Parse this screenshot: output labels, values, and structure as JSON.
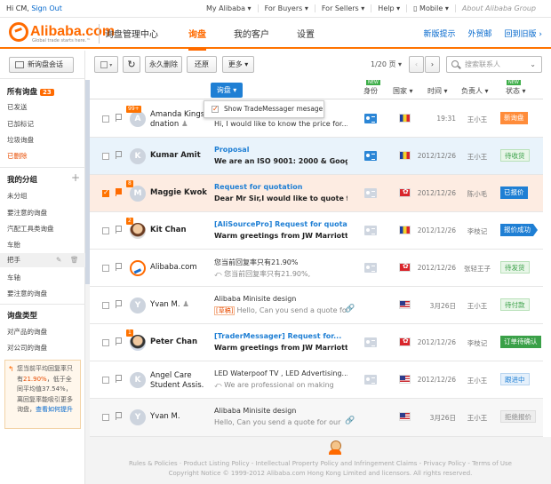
{
  "topbar": {
    "greeting": "Hi CM,",
    "sign_out": "Sign Out",
    "links": [
      "My Alibaba ▾",
      "For Buyers ▾",
      "For Sellers ▾",
      "Help ▾",
      "▯ Mobile ▾",
      "About Alibaba Group"
    ]
  },
  "header": {
    "logo_text": "Alibaba.com",
    "logo_slogan": "Global trade starts here.™",
    "app_title": "询盘管理中心",
    "nav": [
      "询盘",
      "我的客户",
      "设置"
    ],
    "links": [
      "新版提示",
      "外贸邮",
      "回到旧版 ›"
    ]
  },
  "sidebar": {
    "new_inquiry": "新询盘会话",
    "all_inquiries": "所有询盘",
    "all_count": "23",
    "items": [
      "已发送",
      "已加标记",
      "垃圾询盘",
      "已删除"
    ],
    "groups_title": "我的分组",
    "groups": [
      "未分组",
      "要注意的询盘",
      "汽配工具类询盘",
      "车胎",
      "把手",
      "车轴",
      "要注意的询盘"
    ],
    "types_title": "询盘类型",
    "types": [
      "对产品的询盘",
      "对公司的询盘"
    ],
    "promo_pre": "您当前平均回复率只有",
    "promo_rate": "21.90%",
    "promo_mid": "，低于全同平均值",
    "promo_avg": "37.54%",
    "promo_post": "，离回复率能吸引更多询盘，",
    "promo_link": "查看如何提升"
  },
  "toolbar": {
    "delete_forever": "永久删除",
    "restore": "还原",
    "more": "更多 ▾",
    "page": "1/20 页 ▾",
    "prev": "‹",
    "next": "›",
    "search_placeholder": "搜索联系人"
  },
  "list_header": {
    "inquiry": "询盘 ▾",
    "identity": "身份",
    "country": "国家 ▾",
    "time": "时间 ▾",
    "owner": "负责人 ▾",
    "status": "状态 ▾",
    "new_tag": "NEW"
  },
  "dropdown": {
    "option": "Show TradeMessager mesage"
  },
  "rows": [
    {
      "name": "Amanda Kings dnation",
      "count": "99+",
      "subject": "",
      "preview": "Hi, I would like to know the price for...",
      "time": "19:31",
      "owner": "王小王",
      "status": "新询盘"
    },
    {
      "name": "Kumar Amit",
      "initial": "K",
      "subject": "Proposal",
      "preview": "We are an ISO 9001: 2000 & Google...",
      "time": "2012/12/26",
      "owner": "王小王",
      "status": "待收货"
    },
    {
      "name": "Maggie Kwok",
      "count": "8",
      "initial": "M",
      "subject": "Request for quotation",
      "preview": "Dear Mr Sir,I would like to quote for",
      "time": "2012/12/26",
      "owner": "陈小毛",
      "status": "已报价"
    },
    {
      "name": "Kit Chan",
      "count": "2",
      "subject": "[AliSourcePro] Request for quotation...",
      "preview": "Warm greetings from JW Marriott Hotel",
      "time": "2012/12/26",
      "owner": "李枝记",
      "status": "报价成功"
    },
    {
      "name": "Alibaba.com",
      "subject": "您当前回复率只有21.90%",
      "preview": "您当前回复率只有21.90%,",
      "time": "2012/12/26",
      "owner": "张轻王子",
      "status": "待发货"
    },
    {
      "name": "Yvan M.",
      "initial": "Y",
      "subject": "Alibaba Minisite design",
      "preview_tag": "[草稿]",
      "preview": "Hello, Can you send a quote for",
      "time": "3月26日",
      "owner": "王小王",
      "status": "待付款"
    },
    {
      "name": "Peter Chan",
      "count": "1",
      "subject": "[TraderMessager] Request for...",
      "preview": "Warm greetings from JW Marriott",
      "time": "2012/12/26",
      "owner": "李枝记",
      "status": "订单待确认"
    },
    {
      "name": "Angel Care Student Assis.",
      "initial": "K",
      "subject": "LED Waterpoof TV , LED Advertising...",
      "preview": "We are professional on making",
      "time": "2012/12/26",
      "owner": "王小王",
      "status": "跟进中"
    },
    {
      "name": "Yvan M.",
      "initial": "Y",
      "subject": "Alibaba Minisite design",
      "preview": "Hello, Can you send a quote for our",
      "time": "3月26日",
      "owner": "王小王",
      "status": "拒绝报价"
    }
  ],
  "footer": {
    "links": "Rules & Policies · Product Listing Policy - Intellectual Property Policy and Infringement Claims - Privacy Policy - Terms of Use",
    "copyright": "Copyright Notice © 1999-2012 Alibaba.com Hong Kong Limited and licensors. All rights reserved."
  },
  "colors": {
    "accent": "#ff6a00",
    "link": "#1f7fd4",
    "selected_row": "#fdece2",
    "hover_row": "#e9f3fb"
  }
}
